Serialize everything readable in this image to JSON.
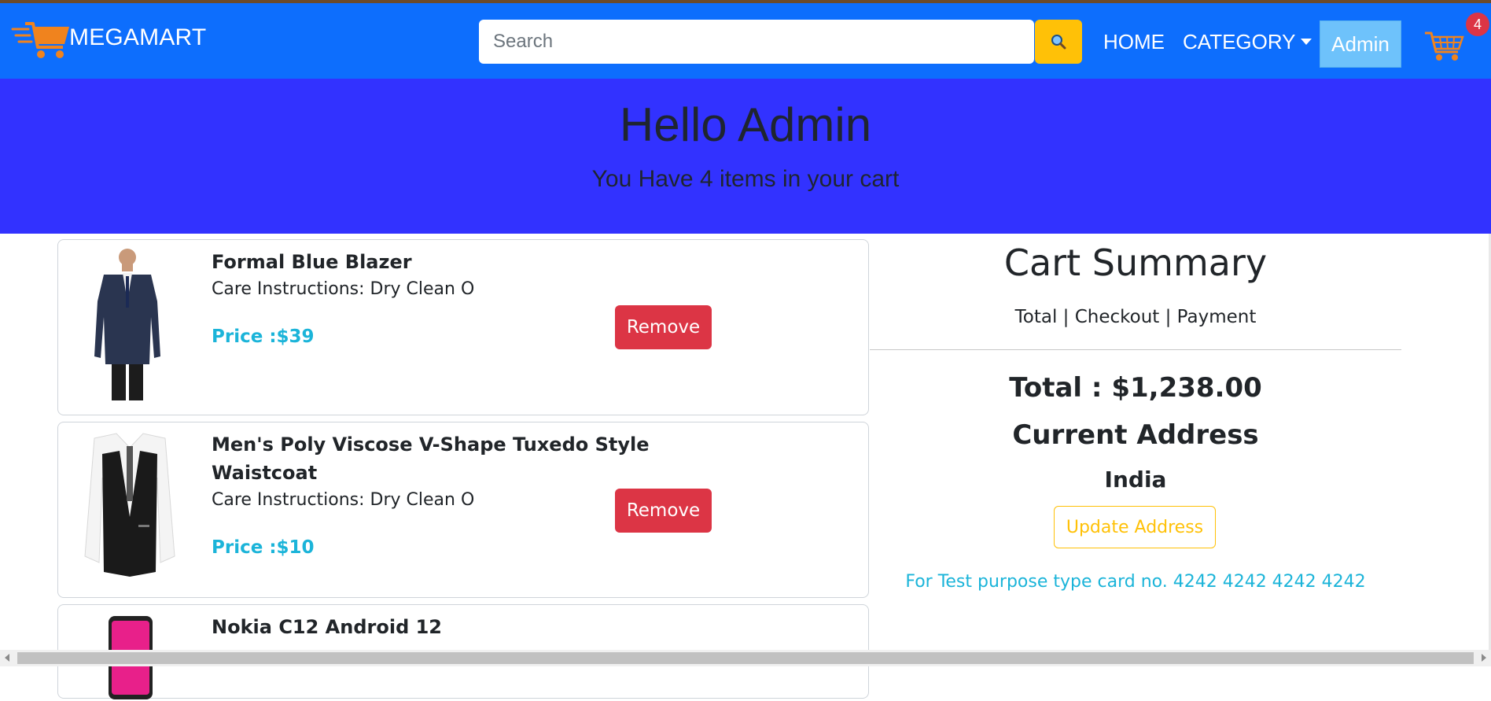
{
  "navbar": {
    "brand": "MEGAMART",
    "search_placeholder": "Search",
    "home": "HOME",
    "category": "CATEGORY",
    "admin": "Admin",
    "cart_count": "4",
    "colors": {
      "bar": "#0d6efd",
      "search_button": "#ffc107",
      "admin_button": "#6ec2fb",
      "badge": "#dc3545"
    }
  },
  "hero": {
    "greeting": "Hello Admin",
    "subtitle": "You Have 4 items in your cart",
    "color": "#3232ff"
  },
  "cart_items": [
    {
      "title": "Formal Blue Blazer",
      "care": "Care Instructions: Dry Clean O",
      "price": "Price :$39",
      "remove": "Remove",
      "image": "blazer-image"
    },
    {
      "title": "Men's Poly Viscose V-Shape Tuxedo Style",
      "title_line2": "Waistcoat",
      "care": "Care Instructions: Dry Clean O",
      "price": "Price :$10",
      "remove": "Remove",
      "image": "waistcoat-image"
    },
    {
      "title": "Nokia C12 Android 12",
      "image": "phone-image"
    }
  ],
  "summary": {
    "title": "Cart Summary",
    "subtitle": "Total | Checkout | Payment",
    "total": "Total : $1,238.00",
    "address_heading": "Current Address",
    "address": "India",
    "update_button": "Update Address",
    "test_note": "For Test purpose type card no. 4242 4242 4242 4242"
  }
}
